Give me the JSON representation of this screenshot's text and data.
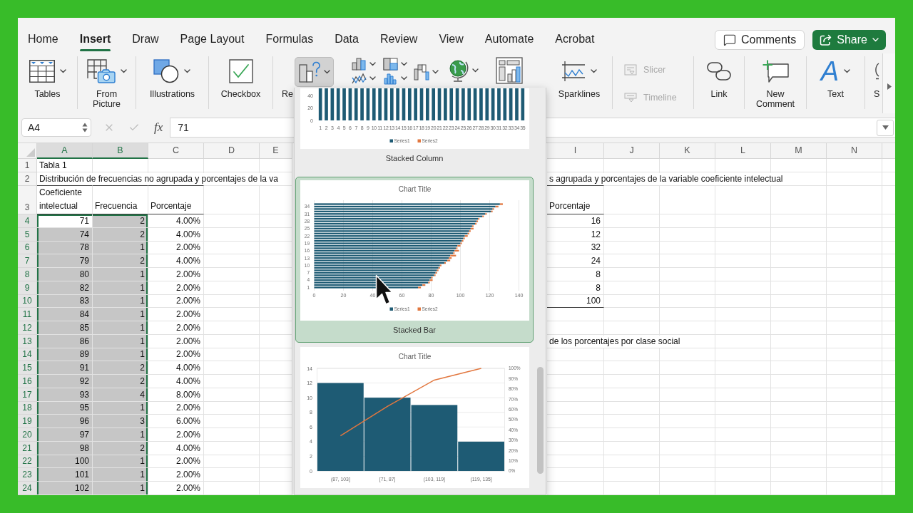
{
  "ribbon_tabs": [
    {
      "label": "Home",
      "selected": false
    },
    {
      "label": "Insert",
      "selected": true
    },
    {
      "label": "Draw",
      "selected": false
    },
    {
      "label": "Page Layout",
      "selected": false
    },
    {
      "label": "Formulas",
      "selected": false
    },
    {
      "label": "Data",
      "selected": false
    },
    {
      "label": "Review",
      "selected": false
    },
    {
      "label": "View",
      "selected": false
    },
    {
      "label": "Automate",
      "selected": false
    },
    {
      "label": "Acrobat",
      "selected": false
    }
  ],
  "comments_button": {
    "label": "Comments"
  },
  "share_button": {
    "label": "Share"
  },
  "ribbon": [
    {
      "kind": "tables",
      "label": "Tables",
      "disabled": false,
      "pressed": false
    },
    {
      "kind": "from_picture",
      "label": "From Picture",
      "disabled": false,
      "pressed": false
    },
    {
      "kind": "illustrations",
      "label": "Illustrations",
      "disabled": false,
      "pressed": false
    },
    {
      "kind": "checkbox",
      "label": "Checkbox",
      "disabled": false,
      "pressed": false
    },
    {
      "kind": "recommended_charts",
      "label": "Re",
      "disabled": false,
      "pressed": true
    },
    {
      "kind": "sparklines",
      "label": "Sparklines",
      "disabled": false,
      "pressed": false
    },
    {
      "kind": "slicer",
      "label": "Slicer",
      "disabled": true,
      "pressed": false
    },
    {
      "kind": "timeline",
      "label": "Timeline",
      "disabled": true,
      "pressed": false
    },
    {
      "kind": "link",
      "label": "Link",
      "disabled": false,
      "pressed": false
    },
    {
      "kind": "new_comment",
      "label": "New Comment",
      "disabled": false,
      "pressed": false
    },
    {
      "kind": "text",
      "label": "Text",
      "icon_char": "A",
      "disabled": false,
      "pressed": false
    },
    {
      "kind": "partial",
      "label": "S",
      "disabled": false,
      "pressed": false
    }
  ],
  "formula_bar": {
    "name_box": "A4",
    "cancel_disabled": true,
    "enter_disabled": true,
    "function_label": "fx",
    "value": "71"
  },
  "columns_left": [
    {
      "label": "A",
      "selected": true
    },
    {
      "label": "B",
      "selected": true
    },
    {
      "label": "C",
      "selected": false
    },
    {
      "label": "D",
      "selected": false
    },
    {
      "label": "E",
      "selected": false
    }
  ],
  "columns_right": [
    {
      "label": "I",
      "selected": false
    },
    {
      "label": "J",
      "selected": false
    },
    {
      "label": "K",
      "selected": false
    },
    {
      "label": "L",
      "selected": false
    },
    {
      "label": "M",
      "selected": false
    },
    {
      "label": "N",
      "selected": false
    }
  ],
  "rows": [
    {
      "number": "1",
      "selected": false,
      "active": false,
      "left": {
        "kind": "label",
        "text": "Tabla 1"
      }
    },
    {
      "number": "2",
      "selected": false,
      "active": false,
      "left": {
        "kind": "title",
        "text": "Distribución de frecuencias no agrupada y porcentajes de la va"
      },
      "right": {
        "kind": "title",
        "text": "s agrupada y porcentajes de la variable coeficiente intelectual"
      }
    },
    {
      "number": "3",
      "selected": false,
      "active": false,
      "left": {
        "kind": "header",
        "cells": [
          "Coeficiente intelectual",
          "Frecuencia",
          "Porcentaje"
        ]
      },
      "right": {
        "kind": "header",
        "cells": [
          "Porcentaje"
        ]
      }
    },
    {
      "number": "4",
      "selected": true,
      "active": true,
      "left": {
        "kind": "data",
        "cells": [
          "71",
          "2",
          "4.00%"
        ]
      },
      "right": {
        "kind": "data",
        "cells": [
          "16"
        ]
      }
    },
    {
      "number": "5",
      "selected": true,
      "active": false,
      "left": {
        "kind": "data",
        "cells": [
          "74",
          "2",
          "4.00%"
        ]
      },
      "right": {
        "kind": "data",
        "cells": [
          "12"
        ]
      }
    },
    {
      "number": "6",
      "selected": true,
      "active": false,
      "left": {
        "kind": "data",
        "cells": [
          "78",
          "1",
          "2.00%"
        ]
      },
      "right": {
        "kind": "data",
        "cells": [
          "32"
        ]
      }
    },
    {
      "number": "7",
      "selected": true,
      "active": false,
      "left": {
        "kind": "data",
        "cells": [
          "79",
          "2",
          "4.00%"
        ]
      },
      "right": {
        "kind": "data",
        "cells": [
          "24"
        ]
      }
    },
    {
      "number": "8",
      "selected": true,
      "active": false,
      "left": {
        "kind": "data",
        "cells": [
          "80",
          "1",
          "2.00%"
        ]
      },
      "right": {
        "kind": "data",
        "cells": [
          "8"
        ]
      }
    },
    {
      "number": "9",
      "selected": true,
      "active": false,
      "left": {
        "kind": "data",
        "cells": [
          "82",
          "1",
          "2.00%"
        ]
      },
      "right": {
        "kind": "data",
        "cells": [
          "8"
        ]
      }
    },
    {
      "number": "10",
      "selected": true,
      "active": false,
      "left": {
        "kind": "data",
        "cells": [
          "83",
          "1",
          "2.00%"
        ]
      },
      "right": {
        "kind": "total",
        "cells": [
          "100"
        ]
      }
    },
    {
      "number": "11",
      "selected": true,
      "active": false,
      "left": {
        "kind": "data",
        "cells": [
          "84",
          "1",
          "2.00%"
        ]
      }
    },
    {
      "number": "12",
      "selected": true,
      "active": false,
      "left": {
        "kind": "data",
        "cells": [
          "85",
          "1",
          "2.00%"
        ]
      }
    },
    {
      "number": "13",
      "selected": true,
      "active": false,
      "left": {
        "kind": "data",
        "cells": [
          "86",
          "1",
          "2.00%"
        ]
      },
      "right": {
        "kind": "label",
        "text": "de los porcentajes por clase social"
      }
    },
    {
      "number": "14",
      "selected": true,
      "active": false,
      "left": {
        "kind": "data",
        "cells": [
          "89",
          "1",
          "2.00%"
        ]
      }
    },
    {
      "number": "15",
      "selected": true,
      "active": false,
      "left": {
        "kind": "data",
        "cells": [
          "91",
          "2",
          "4.00%"
        ]
      }
    },
    {
      "number": "16",
      "selected": true,
      "active": false,
      "left": {
        "kind": "data",
        "cells": [
          "92",
          "2",
          "4.00%"
        ]
      }
    },
    {
      "number": "17",
      "selected": true,
      "active": false,
      "left": {
        "kind": "data",
        "cells": [
          "93",
          "4",
          "8.00%"
        ]
      }
    },
    {
      "number": "18",
      "selected": true,
      "active": false,
      "left": {
        "kind": "data",
        "cells": [
          "95",
          "1",
          "2.00%"
        ]
      }
    },
    {
      "number": "19",
      "selected": true,
      "active": false,
      "left": {
        "kind": "data",
        "cells": [
          "96",
          "3",
          "6.00%"
        ]
      }
    },
    {
      "number": "20",
      "selected": true,
      "active": false,
      "left": {
        "kind": "data",
        "cells": [
          "97",
          "1",
          "2.00%"
        ]
      }
    },
    {
      "number": "21",
      "selected": true,
      "active": false,
      "left": {
        "kind": "data",
        "cells": [
          "98",
          "2",
          "4.00%"
        ]
      }
    },
    {
      "number": "22",
      "selected": true,
      "active": false,
      "left": {
        "kind": "data",
        "cells": [
          "100",
          "1",
          "2.00%"
        ]
      }
    },
    {
      "number": "23",
      "selected": true,
      "active": false,
      "left": {
        "kind": "data",
        "cells": [
          "101",
          "1",
          "2.00%"
        ]
      }
    },
    {
      "number": "24",
      "selected": true,
      "active": false,
      "left": {
        "kind": "data",
        "cells": [
          "102",
          "1",
          "2.00%"
        ]
      }
    }
  ],
  "chart_gallery": [
    {
      "kind": "stacked_column",
      "label": "Stacked Column",
      "selected": false,
      "y_labels": [
        "40",
        "20",
        "0"
      ],
      "x_labels": [
        "1",
        "2",
        "3",
        "4",
        "5",
        "6",
        "7",
        "8",
        "9",
        "10",
        "11",
        "12",
        "13",
        "14",
        "15",
        "16",
        "17",
        "18",
        "19",
        "20",
        "21",
        "22",
        "23",
        "24",
        "25",
        "26",
        "27",
        "28",
        "29",
        "30",
        "31",
        "32",
        "33",
        "34",
        "35"
      ],
      "legend": [
        {
          "label": "Series1",
          "color": "#1e5b74"
        },
        {
          "label": "Series2",
          "color": "#e2773f"
        }
      ]
    },
    {
      "kind": "stacked_bar",
      "label": "Stacked Bar",
      "selected": true,
      "chart_data": {
        "type": "bar",
        "orientation": "horizontal",
        "stacked": true,
        "title": "Chart Title",
        "categories": [
          null,
          "34",
          null,
          null,
          "31",
          null,
          null,
          "28",
          null,
          null,
          "25",
          null,
          null,
          "22",
          null,
          null,
          "19",
          null,
          null,
          "16",
          null,
          null,
          "13",
          null,
          null,
          "10",
          null,
          null,
          "7",
          null,
          null,
          "4",
          null,
          null,
          "1"
        ],
        "series": [
          {
            "name": "Series1",
            "color": "#1e5b74",
            "values": [
              127,
              124,
              122,
              121,
              117,
              115,
              112,
              111,
              110,
              108,
              107,
              106,
              105,
              103,
              102,
              101,
              100,
              98,
              97,
              96,
              95,
              93,
              92,
              91,
              89,
              86,
              85,
              84,
              83,
              82,
              80,
              79,
              78,
              74,
              71
            ]
          },
          {
            "name": "Series2",
            "color": "#e2773f",
            "values": [
              2,
              2,
              1,
              1,
              1,
              1,
              1,
              1,
              1,
              1,
              2,
              1,
              1,
              2,
              1,
              1,
              1,
              2,
              1,
              3,
              1,
              4,
              2,
              2,
              1,
              1,
              1,
              1,
              1,
              1,
              1,
              2,
              1,
              2,
              2
            ]
          }
        ],
        "xlim": [
          0,
          140
        ],
        "xticks": [
          0,
          20,
          40,
          60,
          80,
          100,
          120,
          140
        ],
        "grid": true,
        "legend": "bottom"
      }
    },
    {
      "kind": "pareto",
      "selected": false,
      "chart_data": {
        "type": "bar",
        "title": "Chart Title",
        "categories": [
          "(87, 103]",
          "[71, 87]",
          "(103, 119]",
          "(119, 135]"
        ],
        "series": [
          {
            "type": "bar",
            "color": "#1e5b74",
            "values": [
              12,
              10,
              9,
              4
            ]
          },
          {
            "type": "line",
            "axis": "y2",
            "color": "#e2773f",
            "values": [
              34.3,
              62.9,
              88.6,
              100
            ]
          }
        ],
        "ylim": [
          0,
          14
        ],
        "yticks": [
          0,
          2,
          4,
          6,
          8,
          10,
          12,
          14
        ],
        "y2lim": [
          0,
          100
        ],
        "y2ticks": [
          {
            "value": 0,
            "label": "0%"
          },
          {
            "value": 10,
            "label": "10%"
          },
          {
            "value": 20,
            "label": "20%"
          },
          {
            "value": 30,
            "label": "30%"
          },
          {
            "value": 40,
            "label": "40%"
          },
          {
            "value": 50,
            "label": "50%"
          },
          {
            "value": 60,
            "label": "60%"
          },
          {
            "value": 70,
            "label": "70%"
          },
          {
            "value": 80,
            "label": "80%"
          },
          {
            "value": 90,
            "label": "90%"
          },
          {
            "value": 100,
            "label": "100%"
          }
        ],
        "grid": true
      }
    }
  ]
}
